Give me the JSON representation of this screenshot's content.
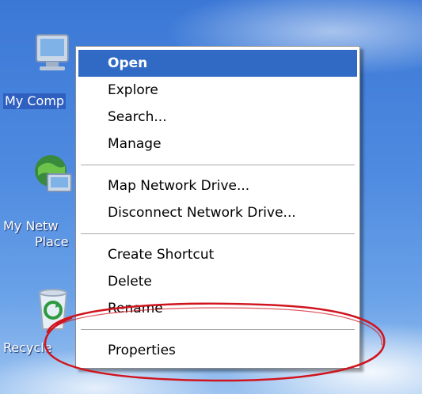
{
  "desktop": {
    "icons": [
      {
        "label": "My Comp",
        "icon": "my-computer-icon",
        "selected": true
      },
      {
        "label_line1": "My Netw",
        "label_line2": "Place",
        "icon": "network-places-icon"
      },
      {
        "label": "Recycle",
        "icon": "recycle-bin-icon"
      }
    ]
  },
  "context_menu": {
    "items": [
      {
        "label": "Open",
        "highlighted": true
      },
      {
        "label": "Explore"
      },
      {
        "label": "Search..."
      },
      {
        "label": "Manage"
      },
      {
        "label": "Map Network Drive..."
      },
      {
        "label": "Disconnect Network Drive..."
      },
      {
        "label": "Create Shortcut"
      },
      {
        "label": "Delete"
      },
      {
        "label": "Rename"
      },
      {
        "label": "Properties",
        "annotated": true
      }
    ]
  },
  "colors": {
    "highlight": "#316ac5",
    "annotation": "#d0141e",
    "desktop_blue": "#3b78d6"
  }
}
